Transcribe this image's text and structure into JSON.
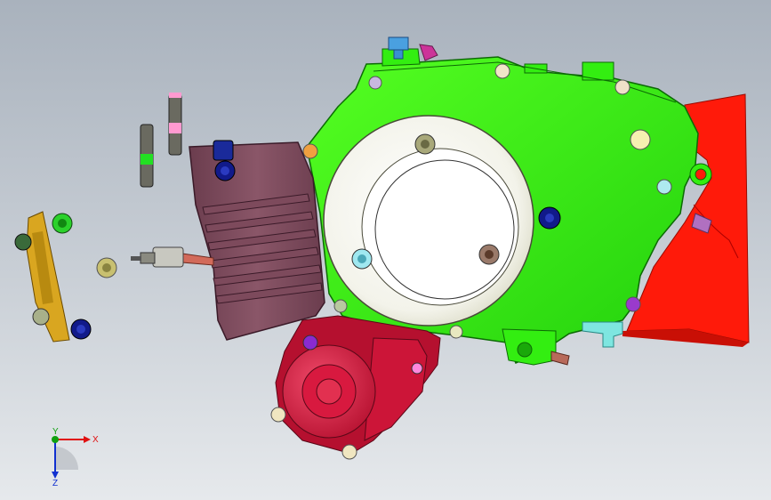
{
  "viewport": {
    "background_top": "#a9b2bd",
    "background_bottom": "#e6e9ec"
  },
  "colors": {
    "crankcase_cover": "#33ee11",
    "cylinder": "#7a4a5a",
    "starter_motor": "#d8193f",
    "frame_bracket": "#ff1a0a",
    "gasket": "#d9a620",
    "bolt_blue": "#111a8a",
    "bolt_green": "#2bd12b",
    "spark_plug_wire": "#d26a5a"
  },
  "triad": {
    "x_label": "X",
    "y_label": "Y",
    "z_label": "Z",
    "x_color": "#e01010",
    "y_color": "#10a010",
    "z_color": "#1030d0"
  }
}
